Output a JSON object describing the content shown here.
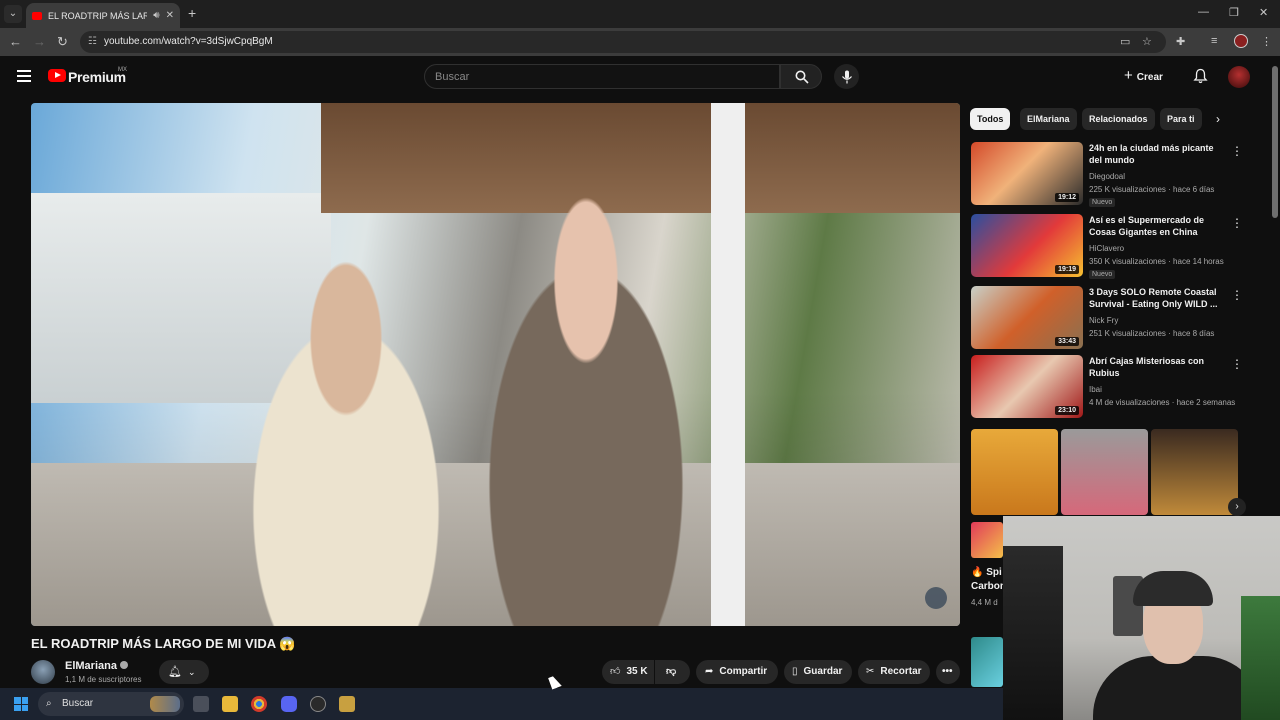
{
  "browser": {
    "tab_title": "EL ROADTRIP MÁS LARGO I",
    "url": "youtube.com/watch?v=3dSjwCpqBgM"
  },
  "youtube": {
    "logo_text": "Premium",
    "country": "MX",
    "search_placeholder": "Buscar",
    "create_label": "Crear"
  },
  "video": {
    "title": "EL ROADTRIP MÁS LARGO DE MI VIDA 😱",
    "channel": "ElMariana",
    "subscribers": "1,1 M de suscriptores",
    "likes": "35 K",
    "share_label": "Compartir",
    "save_label": "Guardar",
    "clip_label": "Recortar"
  },
  "chips": [
    "Todos",
    "ElMariana",
    "Relacionados",
    "Para ti"
  ],
  "recommendations": [
    {
      "title": "24h en la ciudad más picante del mundo",
      "channel": "Diegodoal",
      "meta": "225 K visualizaciones · hace 6 días",
      "duration": "19:12",
      "badge": "Nuevo"
    },
    {
      "title": "Así es el Supermercado de Cosas Gigantes en China",
      "channel": "HiClavero",
      "meta": "350 K visualizaciones · hace 14 horas",
      "duration": "19:19",
      "badge": "Nuevo"
    },
    {
      "title": "3 Days SOLO Remote Coastal Survival - Eating Only WILD ...",
      "channel": "Nick Fry",
      "meta": "251 K visualizaciones · hace 8 días",
      "duration": "33:43",
      "badge": ""
    },
    {
      "title": "Abrí Cajas Misteriosas con Rubius",
      "channel": "Ibai",
      "meta": "4 M de visualizaciones · hace 2 semanas",
      "duration": "23:10",
      "badge": ""
    }
  ],
  "peek": {
    "title_line1": "🔥 Spi",
    "title_line2": "Carbon",
    "meta": "4,4 M d"
  },
  "taskbar": {
    "search_label": "Buscar"
  },
  "colors": {
    "background": "#0f0f0f",
    "youtube_red": "#ff0000",
    "surface": "#272727"
  }
}
